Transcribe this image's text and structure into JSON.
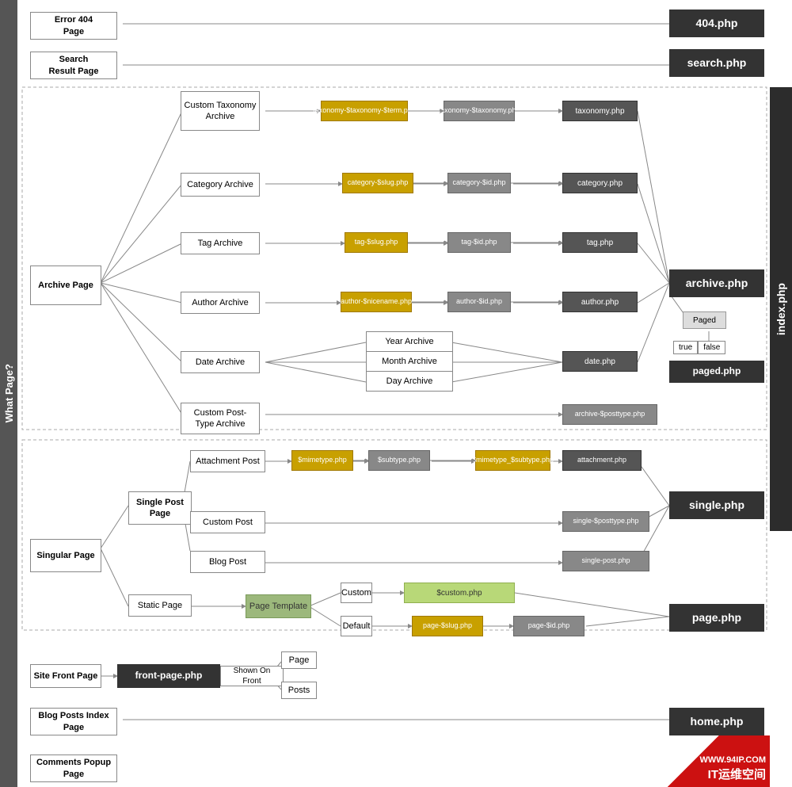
{
  "leftLabel": "What Page?",
  "rightLabel": "index.php",
  "sections": {
    "error404": {
      "label": "Error 404\nPage",
      "file": "404.php"
    },
    "searchResult": {
      "label": "Search\nResult Page",
      "file": "search.php"
    },
    "archivePage": {
      "label": "Archive\nPage"
    },
    "singularPage": {
      "label": "Singular\nPage"
    },
    "siteFront": {
      "label": "Site Front\nPage"
    },
    "blogPosts": {
      "label": "Blog Posts\nIndex Page",
      "file": "home.php"
    },
    "comments": {
      "label": "Comments\nPopup Page"
    }
  },
  "nodes": {
    "customTaxonomy": "Custom\nTaxonomy\nArchive",
    "categoryArchive": "Category\nArchive",
    "tagArchive": "Tag Archive",
    "authorArchive": "Author Archive",
    "dateArchive": "Date Archive",
    "yearArchive": "Year Archive",
    "monthArchive": "Month Archive",
    "dayArchive": "Day Archive",
    "customPostTypeArchive": "Custom Post-\nType Archive",
    "singlePostPage": "Single Post\nPage",
    "attachmentPost": "Attachment\nPost",
    "customPost": "Custom Post",
    "blogPost": "Blog Post",
    "staticPage": "Static Page",
    "pageTemplate": "Page Template",
    "custom": "Custom",
    "default": "Default",
    "shownOnFront": "Shown On Front",
    "page": "Page",
    "posts": "Posts"
  },
  "files": {
    "f404": "404.php",
    "search": "search.php",
    "taxonomyFull": "taxonomy-$taxonomy-$term.php",
    "taxonomyShort": "taxonomy-$taxonomy.php",
    "taxonomyBase": "taxonomy.php",
    "categorySlug": "category-$slug.php",
    "categoryId": "category-$id.php",
    "categoryBase": "category.php",
    "tagSlug": "tag-$slug.php",
    "tagId": "tag-$id.php",
    "tagBase": "tag.php",
    "authorNicename": "author-$nicename.php",
    "authorId": "author-$id.php",
    "authorBase": "author.php",
    "dateBase": "date.php",
    "archivePosttype": "archive-$posttype.php",
    "archiveBase": "archive.php",
    "pagedBase": "paged.php",
    "mimetype": "$mimetype.php",
    "subtype": "$subtype.php",
    "mimetypeSubtype": "$mimetype_$subtype.php",
    "attachmentBase": "attachment.php",
    "singleBase": "single.php",
    "singlePosttype": "single-$posttype.php",
    "singlePost": "single-post.php",
    "scustom": "$custom.php",
    "pageSlug": "page-$slug.php",
    "pageId": "page-$id.php",
    "pageBase": "page.php",
    "frontPage": "front-page.php",
    "homeBase": "home.php",
    "index": "index.php",
    "pagedLabel": "Paged",
    "trueLabel": "true",
    "falseLabel": "false"
  },
  "watermark": {
    "line1": "WWW.94IP.COM",
    "line2": "IT运维空间"
  }
}
